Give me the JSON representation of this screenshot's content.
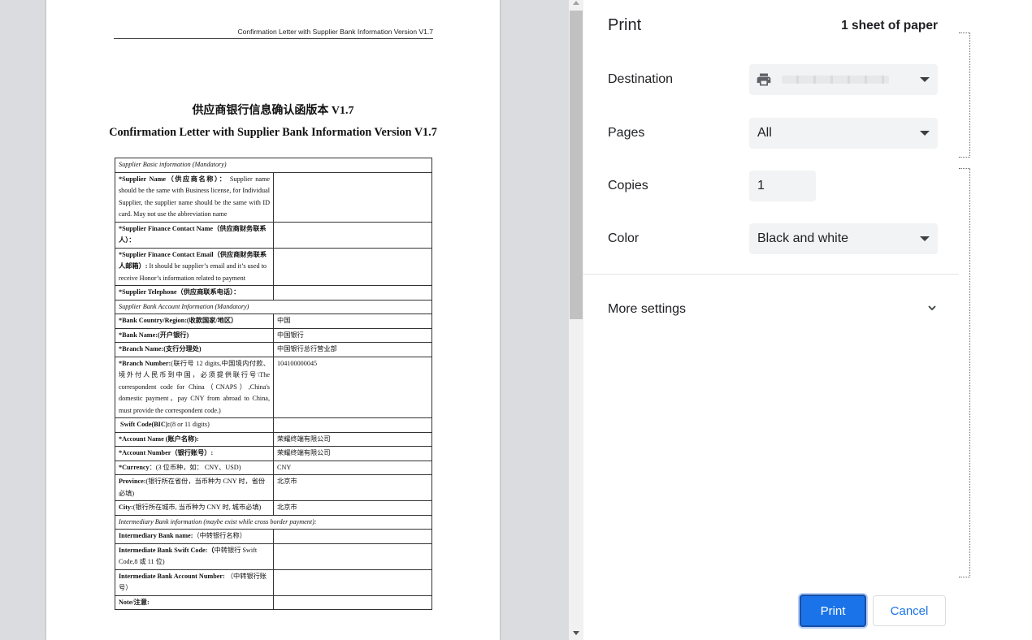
{
  "document": {
    "header": "Confirmation Letter with Supplier Bank Information Version V1.7",
    "title_cn": "供应商银行信息确认函版本 V1.7",
    "title_en": "Confirmation Letter with Supplier Bank Information Version V1.7",
    "sections": {
      "basic": "Supplier Basic information (Mandatory)",
      "bank": "Supplier Bank Account Information (Mandatory)",
      "intermediary": "Intermediary Bank information (maybe exist while cross border payment):"
    },
    "rows": {
      "supplier_name": {
        "label": "*Supplier Name（供应商名称）：",
        "note": " Supplier name should be the same with Business license, for Individual Supplier, the supplier name should be the same with ID card. May not use the abbreviation name",
        "value": ""
      },
      "finance_contact_name": {
        "label": "*Supplier Finance Contact Name（供应商财务联系人）：",
        "value": ""
      },
      "finance_contact_email": {
        "label": "*Supplier Finance Contact Email（供应商财务联系人邮箱）:",
        "note": " It should be supplier’s email and it’s used to receive Honor’s information related to payment",
        "value": ""
      },
      "telephone": {
        "label": "*Supplier Telephone（供应商联系电话）：",
        "value": ""
      },
      "bank_country": {
        "label": "*Bank Country/Region:(收款国家/地区）",
        "value": "中国"
      },
      "bank_name": {
        "label": "*Bank Name:(开户银行)",
        "value": "中国银行"
      },
      "branch_name": {
        "label": "*Branch Name:(支行分理处)",
        "value": "中国银行总行营业部"
      },
      "branch_number": {
        "label": "*Branch Number:",
        "note": "(联行号 12 digits,中国境内付款、境外付人民币到中国，必须提供联行号\\The correspondent code for China（CNAPS）,China's domestic payment，pay CNY from abroad to China, must provide the correspondent code.)",
        "value": "104100000045"
      },
      "swift_code": {
        "label": "Swift Code(BIC):",
        "note": "(8 or 11 digits)",
        "value": ""
      },
      "account_name": {
        "label": "*Account Name (账户名称):",
        "value": "荣耀终端有限公司"
      },
      "account_number": {
        "label": "*Account Number（银行账号）:",
        "value": "荣耀终端有限公司"
      },
      "currency": {
        "label": "*Currency",
        "note": "：(3 位币种，如： CNY、USD)",
        "value": "CNY"
      },
      "province": {
        "label": "Province:",
        "note": "(银行所在省份，当币种为 CNY 时，省份必填)",
        "value": "北京市"
      },
      "city": {
        "label": "City:",
        "note": "(银行所在城市, 当币种为 CNY 时, 城市必填)",
        "value": "北京市"
      },
      "inter_bank_name": {
        "label": "Intermediary Bank name:",
        "note": "（中转银行名称）",
        "value": ""
      },
      "inter_swift": {
        "label": "Intermediate Bank Swift Code:（",
        "note": "中转银行 Swift Code,8 或 11 位)",
        "value": ""
      },
      "inter_account": {
        "label": "Intermediate Bank Account Number:",
        "note": " （中转银行账号）",
        "value": ""
      },
      "note": {
        "label": "Note/注意:"
      }
    }
  },
  "panel": {
    "title": "Print",
    "sheet_count": "1 sheet of paper",
    "destination": {
      "label": "Destination",
      "icon": "printer-icon"
    },
    "pages": {
      "label": "Pages",
      "value": "All"
    },
    "copies": {
      "label": "Copies",
      "value": "1"
    },
    "color": {
      "label": "Color",
      "value": "Black and white"
    },
    "more_settings": "More settings",
    "print_button": "Print",
    "cancel_button": "Cancel"
  },
  "colors": {
    "accent": "#1a73e8",
    "field_bg": "#f1f3f4",
    "preview_bg": "#dadcdf"
  }
}
